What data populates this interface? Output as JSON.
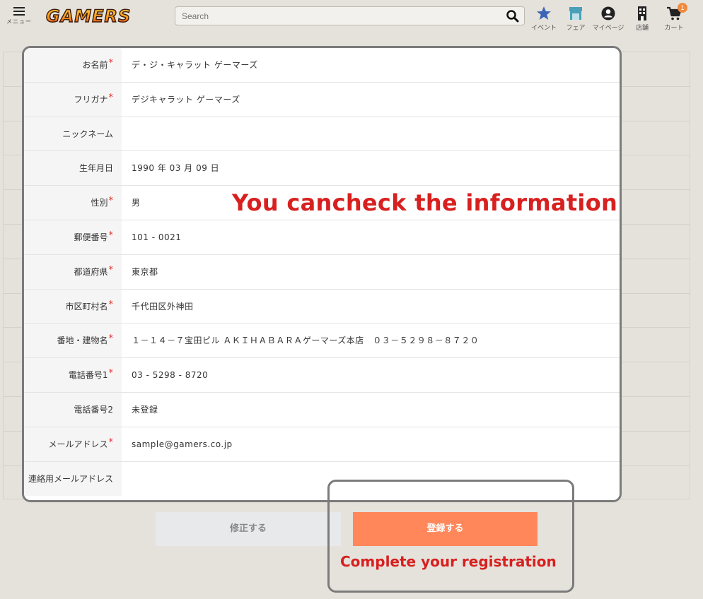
{
  "header": {
    "menu_label": "メニュー",
    "logo_text": "GAMERS",
    "search_placeholder": "Search",
    "nav": [
      {
        "label": "イベント",
        "icon": "star-icon"
      },
      {
        "label": "フェア",
        "icon": "store-icon"
      },
      {
        "label": "マイページ",
        "icon": "user-icon"
      },
      {
        "label": "店舗",
        "icon": "building-icon"
      },
      {
        "label": "カート",
        "icon": "cart-icon"
      }
    ],
    "cart_count": "1"
  },
  "form": {
    "rows": [
      {
        "label": "お名前",
        "required": true,
        "value": "デ・ジ・キャラット ゲーマーズ"
      },
      {
        "label": "フリガナ",
        "required": true,
        "value": "デジキャラット ゲーマーズ"
      },
      {
        "label": "ニックネーム",
        "required": false,
        "value": ""
      },
      {
        "label": "生年月日",
        "required": false,
        "value": "1990 年 03 月 09 日"
      },
      {
        "label": "性別",
        "required": true,
        "value": "男"
      },
      {
        "label": "郵便番号",
        "required": true,
        "value": "101 - 0021"
      },
      {
        "label": "都道府県",
        "required": true,
        "value": "東京都"
      },
      {
        "label": "市区町村名",
        "required": true,
        "value": "千代田区外神田"
      },
      {
        "label": "番地・建物名",
        "required": true,
        "value": "１－１４－７宝田ビル ＡＫＩＨＡＢＡＲＡゲーマーズ本店　０３－５２９８－８７２０"
      },
      {
        "label": "電話番号1",
        "required": true,
        "value": "03 - 5298 - 8720"
      },
      {
        "label": "電話番号2",
        "required": false,
        "value": "未登録"
      },
      {
        "label": "メールアドレス",
        "required": true,
        "value": "sample@gamers.co.jp"
      },
      {
        "label": "連絡用メールアドレス",
        "required": false,
        "value": ""
      }
    ],
    "required_mark": "*"
  },
  "buttons": {
    "fix_label": "修正する",
    "register_label": "登録する"
  },
  "annotations": {
    "main": "You cancheck the information",
    "sub": "Complete your registration"
  },
  "colors": {
    "accent": "#ff875a",
    "annotation": "#d7201f",
    "required": "#e0332e",
    "star": "#3c63b5",
    "store": "#4aa0b8"
  }
}
